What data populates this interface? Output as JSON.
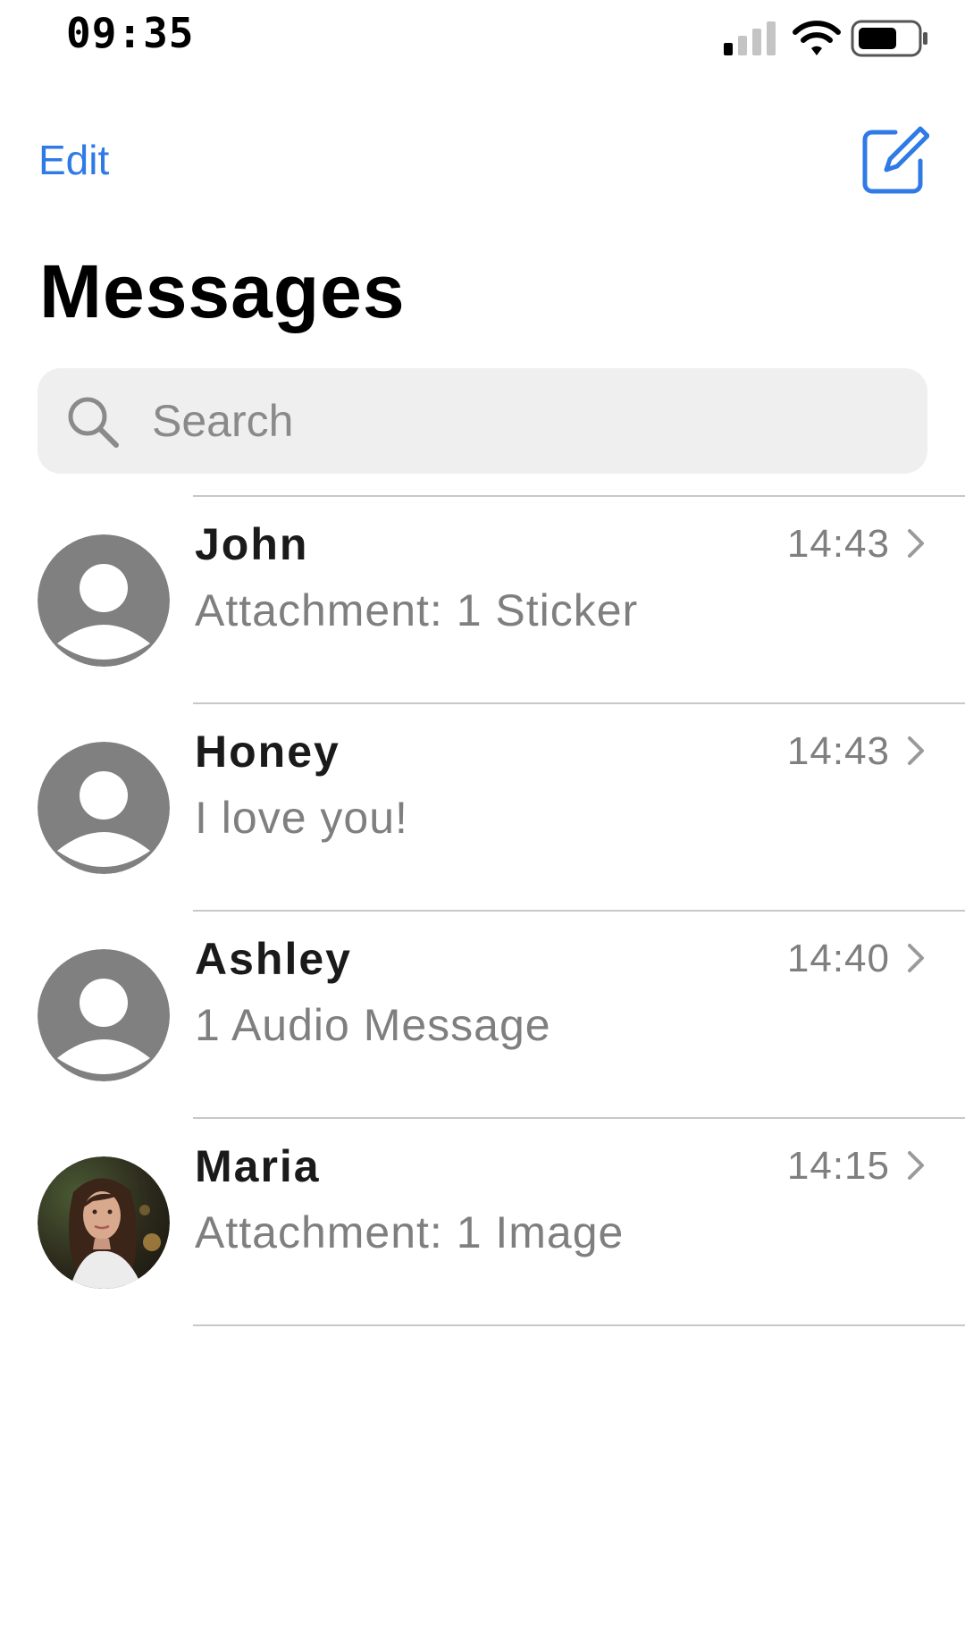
{
  "status_bar": {
    "time": "09:35",
    "signal_icon": "cellular-signal-icon",
    "wifi_icon": "wifi-icon",
    "battery_icon": "battery-icon"
  },
  "nav": {
    "edit_label": "Edit",
    "compose_icon": "compose-icon"
  },
  "title": "Messages",
  "search": {
    "placeholder": "Search",
    "icon": "search-icon"
  },
  "colors": {
    "accent": "#2f7ae5",
    "secondary_text": "#7f7f7f",
    "avatar_placeholder": "#808080",
    "search_background": "#efefef"
  },
  "conversations": [
    {
      "name": "John",
      "preview": "Attachment: 1 Sticker",
      "time": "14:43",
      "avatar": "person-placeholder-icon"
    },
    {
      "name": "Honey",
      "preview": "I love you!",
      "time": "14:43",
      "avatar": "person-placeholder-icon"
    },
    {
      "name": "Ashley",
      "preview": "1 Audio Message",
      "time": "14:40",
      "avatar": "person-placeholder-icon"
    },
    {
      "name": "Maria",
      "preview": "Attachment: 1 Image",
      "time": "14:15",
      "avatar": "photo"
    }
  ]
}
